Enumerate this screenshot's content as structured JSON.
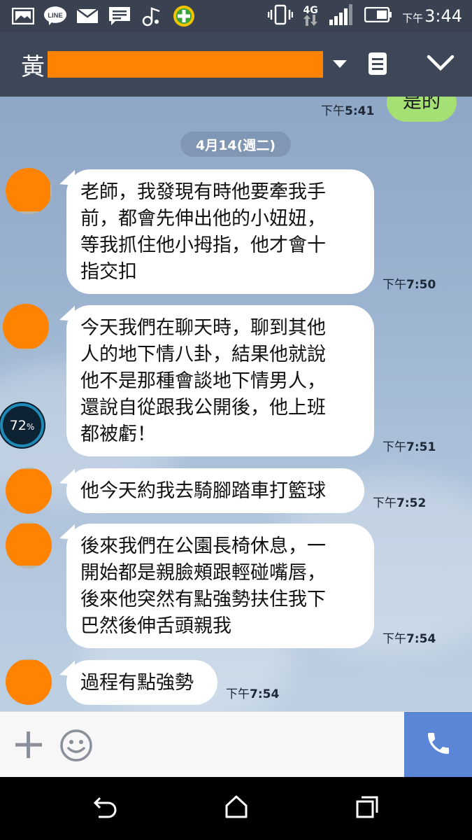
{
  "status_bar": {
    "icons": [
      "image-icon",
      "line-app-icon",
      "mail-icon",
      "message-icon",
      "music-icon",
      "plus-badge-icon"
    ],
    "vibrate_icon": "vibrate-icon",
    "network": "4G",
    "signal_icon": "signal-icon",
    "battery_icon": "battery-icon",
    "time_ampm": "下午",
    "time": "3:44"
  },
  "header": {
    "name_first_char": "黃",
    "icons": [
      "dropdown-caret-icon",
      "memo-icon",
      "collapse-chevron-icon"
    ]
  },
  "chat": {
    "prev_sent": {
      "text": "是的",
      "time_ampm": "下午",
      "time": "5:41"
    },
    "date_separator": "4月14(週二)",
    "messages": [
      {
        "lines": [
          "老師，我發現有時他要牽我手",
          "前，都會先伸出他的小妞妞，",
          "等我抓住他小拇指，他才會十",
          "指交扣"
        ],
        "time_ampm": "下午",
        "time": "7:50"
      },
      {
        "lines": [
          "今天我們在聊天時，聊到其他",
          "人的地下情八卦，結果他就說",
          "他不是那種會談地下情男人，",
          "還說自從跟我公開後，他上班",
          "都被虧！"
        ],
        "time_ampm": "下午",
        "time": "7:51"
      },
      {
        "lines": [
          "他今天約我去騎腳踏車打籃球"
        ],
        "time_ampm": "下午",
        "time": "7:52"
      },
      {
        "lines": [
          "後來我們在公園長椅休息，一",
          "開始都是親臉頰跟輕碰嘴唇，",
          "後來他突然有點強勢扶住我下",
          "巴然後伸舌頭親我"
        ],
        "time_ampm": "下午",
        "time": "7:54"
      },
      {
        "lines": [
          "過程有點強勢"
        ],
        "time_ampm": "下午",
        "time": "7:54"
      }
    ],
    "battery_widget": {
      "value": "72",
      "unit": "%"
    }
  },
  "input_bar": {
    "icons": [
      "plus-icon",
      "emoji-icon",
      "phone-icon"
    ]
  },
  "navbar": {
    "icons": [
      "back-icon",
      "home-icon",
      "recents-icon"
    ]
  },
  "colors": {
    "status_bar": "#3a4150",
    "header": "#3e4758",
    "redaction": "#ff8200",
    "sent_bubble": "#a5e075",
    "call_button": "#5b86d6"
  }
}
